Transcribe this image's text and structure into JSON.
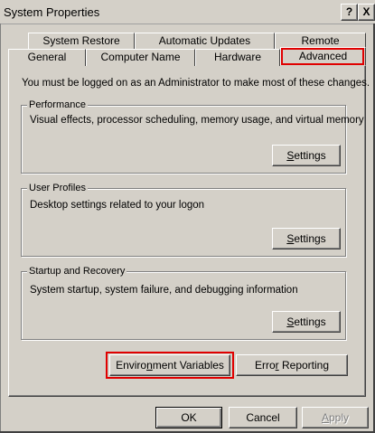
{
  "window": {
    "title": "System Properties",
    "help_glyph": "?",
    "close_glyph": "X"
  },
  "tabs_back": [
    "System Restore",
    "Automatic Updates",
    "Remote"
  ],
  "tabs_front": [
    "General",
    "Computer Name",
    "Hardware",
    "Advanced"
  ],
  "admin_note": "You must be logged on as an Administrator to make most of these changes.",
  "performance": {
    "label": "Performance",
    "description": "Visual effects, processor scheduling, memory usage, and virtual memory",
    "button": {
      "pre": "",
      "key": "S",
      "post": "ettings"
    }
  },
  "user_profiles": {
    "label": "User Profiles",
    "description": "Desktop settings related to your logon",
    "button": {
      "pre": "",
      "key": "S",
      "post": "ettings"
    }
  },
  "startup": {
    "label": "Startup and Recovery",
    "description": "System startup, system failure, and debugging information",
    "button": {
      "pre": "",
      "key": "S",
      "post": "ettings"
    }
  },
  "env_button": {
    "pre": "Enviro",
    "key": "n",
    "post": "ment Variables"
  },
  "error_button": {
    "pre": "Erro",
    "key": "r",
    "post": " Reporting"
  },
  "footer": {
    "ok": "OK",
    "cancel": "Cancel",
    "apply_pre": "",
    "apply_key": "A",
    "apply_post": "pply"
  },
  "highlight_color": "#e00000"
}
